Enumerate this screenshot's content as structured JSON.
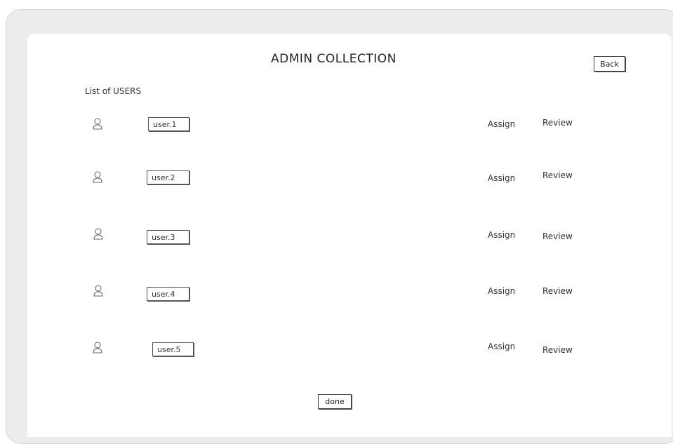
{
  "header": {
    "title": "ADMIN COLLECTION",
    "back_label": "Back"
  },
  "list": {
    "heading": "List of USERS",
    "users": [
      {
        "name": "user.1",
        "assign_label": "Assign",
        "review_label": "Review"
      },
      {
        "name": "user.2",
        "assign_label": "Assign",
        "review_label": "Review"
      },
      {
        "name": "user.3",
        "assign_label": "Assign",
        "review_label": "Review"
      },
      {
        "name": "user.4",
        "assign_label": "Assign",
        "review_label": "Review"
      },
      {
        "name": "user.5",
        "assign_label": "Assign",
        "review_label": "Review"
      }
    ]
  },
  "footer": {
    "done_label": "done"
  },
  "icons": {
    "user": "user-icon"
  },
  "colors": {
    "frame": "#ececec",
    "screen": "#ffffff",
    "ink": "#333333"
  }
}
